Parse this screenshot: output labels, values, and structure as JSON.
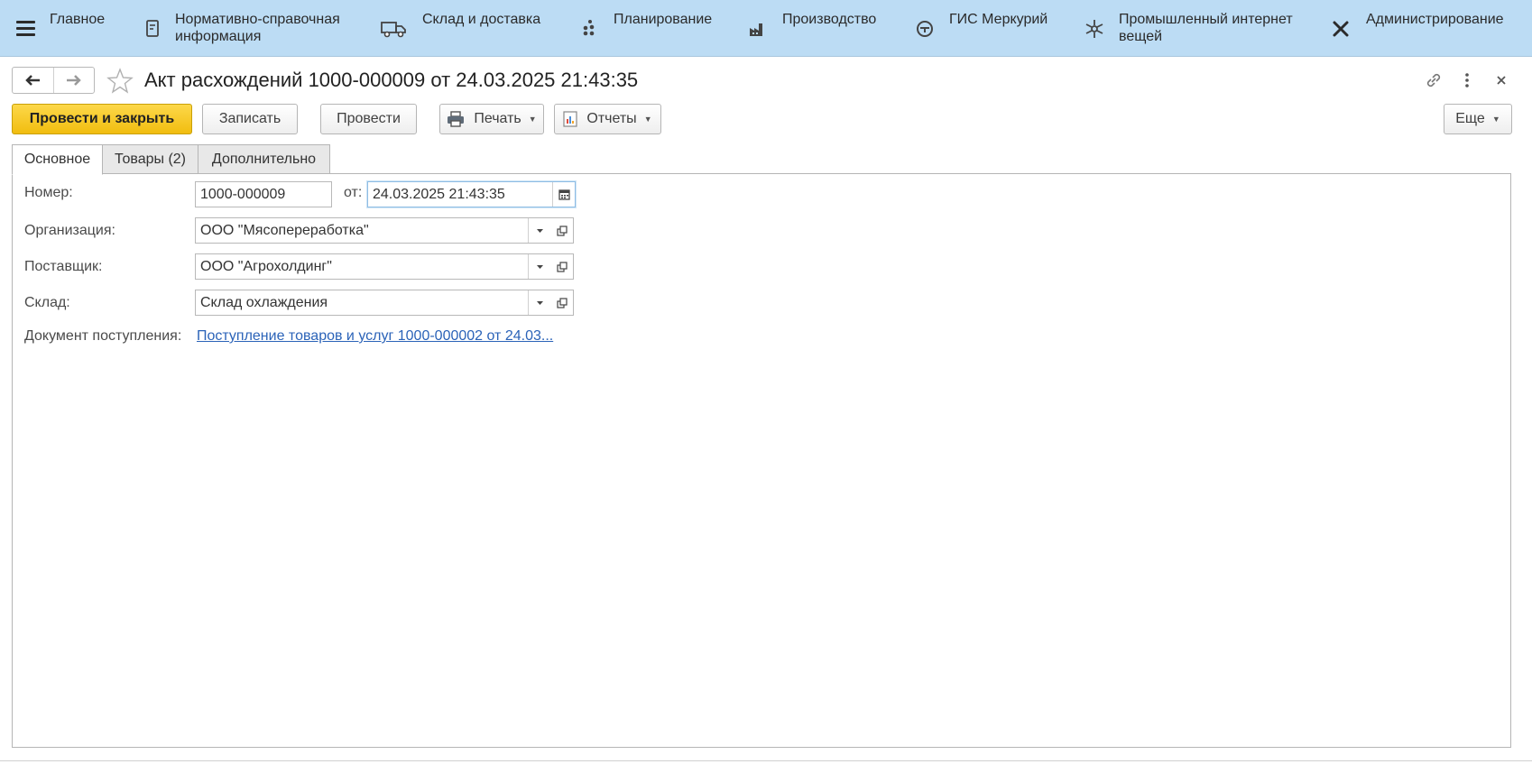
{
  "sections": {
    "main": "Главное",
    "reference": "Нормативно-справочная\nинформация",
    "warehouse": "Склад и доставка",
    "planning": "Планирование",
    "production": "Производство",
    "mercury": "ГИС Меркурий",
    "iiot": "Промышленный интернет\nвещей",
    "admin": "Администрирование"
  },
  "form": {
    "title": "Акт расхождений 1000-000009 от 24.03.2025 21:43:35"
  },
  "commands": {
    "post_close": "Провести и закрыть",
    "save": "Записать",
    "post": "Провести",
    "print": "Печать",
    "reports": "Отчеты",
    "more": "Еще"
  },
  "tabs": {
    "main": "Основное",
    "goods": "Товары (2)",
    "extra": "Дополнительно"
  },
  "fields": {
    "number_label": "Номер:",
    "number_value": "1000-000009",
    "date_label": "от:",
    "date_value": "24.03.2025 21:43:35",
    "org_label": "Организация:",
    "org_value": "ООО \"Мясопереработка\"",
    "supplier_label": "Поставщик:",
    "supplier_value": "ООО \"Агрохолдинг\"",
    "warehouse_label": "Склад:",
    "warehouse_value": "Склад охлаждения",
    "receipt_label": "Документ поступления:",
    "receipt_link": "Поступление товаров и услуг 1000-000002 от 24.03..."
  },
  "colors": {
    "topbar": "#bcdcf4",
    "primary_button": "#f5c518",
    "link": "#2b63b8"
  },
  "icons": [
    "menu-icon",
    "reference-icon",
    "truck-icon",
    "planning-icon",
    "factory-icon",
    "mercury-icon",
    "iiot-icon",
    "tools-icon",
    "back-arrow-icon",
    "forward-arrow-icon",
    "star-icon",
    "link-icon",
    "more-vert-icon",
    "close-icon",
    "printer-icon",
    "report-icon",
    "calendar-icon",
    "chevron-down-icon",
    "open-form-icon"
  ]
}
